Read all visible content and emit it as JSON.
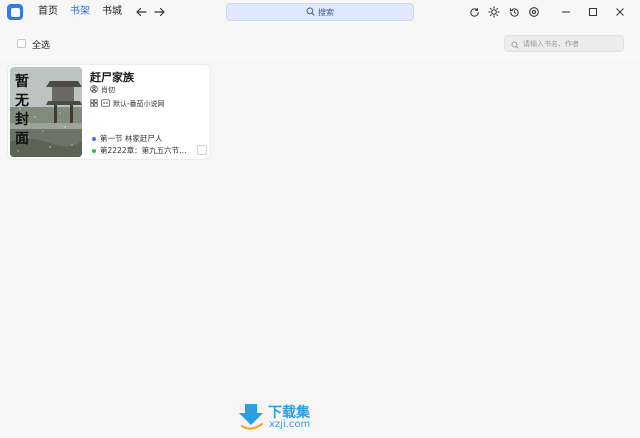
{
  "titlebar": {
    "tabs": [
      {
        "label": "首页"
      },
      {
        "label": "书架"
      },
      {
        "label": "书城"
      }
    ],
    "search_label": "搜索",
    "accent_color": "#2f6fe0"
  },
  "toolbar": {
    "select_all_label": "全选",
    "filter_placeholder": "请输入书名、作者"
  },
  "books": [
    {
      "cover_text": "暂无封面",
      "title": "赶尸家族",
      "author": "肖仞",
      "source": "默认-番茄小说网",
      "last_read_chapter": "第一节 林家赶尸人",
      "latest_chapter": "第2222章：第九五六节…",
      "last_read_color": "#3a7bd5",
      "latest_color": "#3bb84a"
    }
  ],
  "watermark": {
    "name": "下载集",
    "domain": "xzji.com"
  }
}
